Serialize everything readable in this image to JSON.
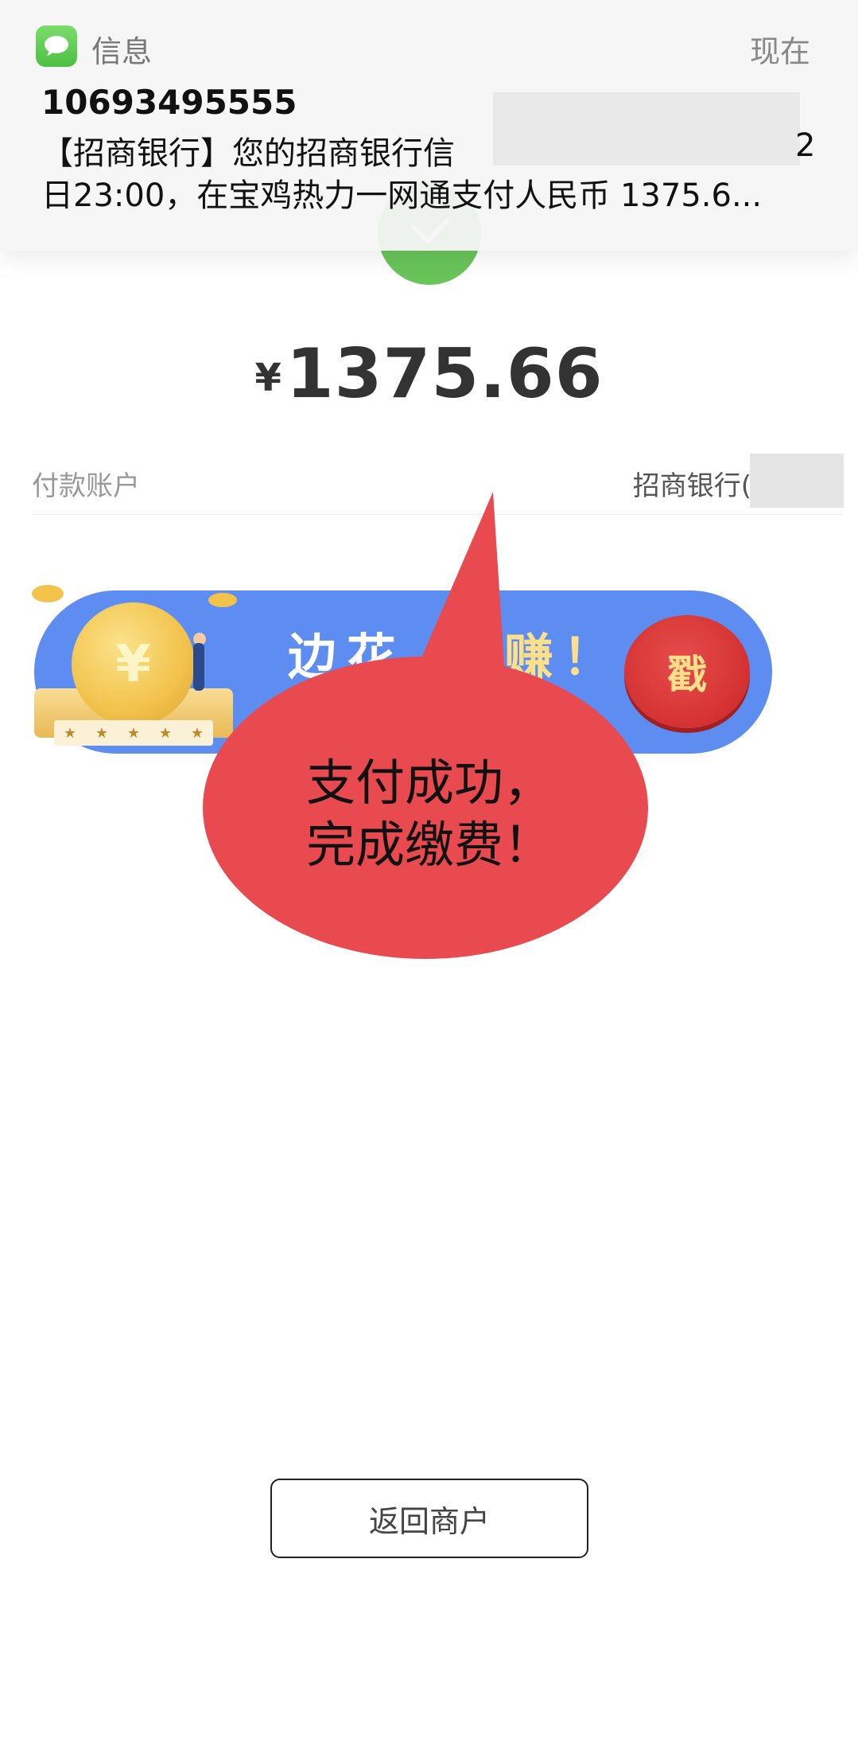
{
  "notification": {
    "app_name": "信息",
    "time": "现在",
    "sender": "10693495555",
    "line1": "【招商银行】您的招商银行信",
    "line1_tail": "2",
    "line2": "日23:00，在宝鸡热力一网通支付人民币 1375.6..."
  },
  "payment": {
    "currency_symbol": "¥",
    "amount": "1375.66",
    "account_label": "付款账户",
    "account_value": "招商银行("
  },
  "banner": {
    "text": "边花",
    "text_tail": "赚！",
    "coin_symbol": "¥",
    "poke_label": "戳",
    "stars": [
      "★",
      "★",
      "★",
      "★",
      "★"
    ]
  },
  "callout": {
    "line1": "支付成功，",
    "line2": "完成缴费！",
    "color": "#e84a4f"
  },
  "actions": {
    "back_label": "返回商户"
  },
  "colors": {
    "success_green": "#69c45a",
    "banner_blue": "#5e8df2"
  }
}
